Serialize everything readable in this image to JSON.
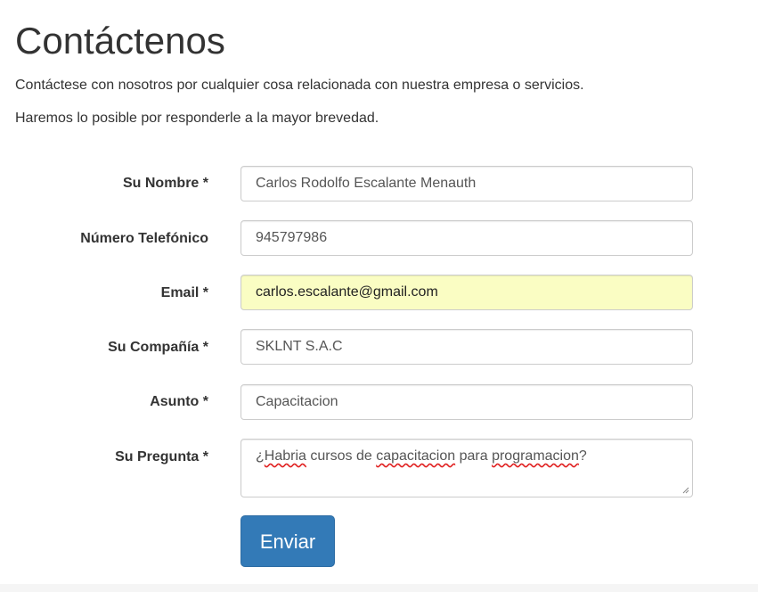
{
  "page": {
    "title": "Contáctenos",
    "intro_1": "Contáctese con nosotros por cualquier cosa relacionada con nuestra empresa o servicios.",
    "intro_2": "Haremos lo posible por responderle a la mayor brevedad."
  },
  "form": {
    "name": {
      "label": "Su Nombre *",
      "value": "Carlos Rodolfo Escalante Menauth"
    },
    "phone": {
      "label": "Número Telefónico",
      "value": "945797986"
    },
    "email": {
      "label": "Email *",
      "value": "carlos.escalante@gmail.com"
    },
    "company": {
      "label": "Su Compañía *",
      "value": "SKLNT S.A.C"
    },
    "subject": {
      "label": "Asunto *",
      "value": "Capacitacion"
    },
    "question": {
      "label": "Su Pregunta *",
      "parts": [
        "¿",
        "Habria",
        " cursos de ",
        "capacitacion",
        " para ",
        "programacion",
        "?"
      ]
    },
    "submit_label": "Enviar"
  },
  "colors": {
    "primary_button": "#337ab7",
    "autofill_background": "#fafdc3"
  }
}
